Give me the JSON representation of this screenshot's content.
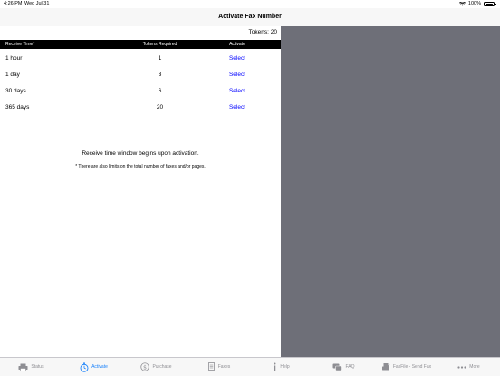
{
  "status_bar": {
    "time": "4:26 PM",
    "date": "Wed Jul 31",
    "battery": "100%"
  },
  "nav": {
    "title": "Activate Fax Number"
  },
  "tokens": {
    "label": "Tokens:",
    "value": "20"
  },
  "table": {
    "headers": [
      "Receive Time*",
      "Tokens Required",
      "Activate"
    ],
    "rows": [
      {
        "time": "1 hour",
        "tokens": "1",
        "action": "Select"
      },
      {
        "time": "1 day",
        "tokens": "3",
        "action": "Select"
      },
      {
        "time": "30 days",
        "tokens": "6",
        "action": "Select"
      },
      {
        "time": "365 days",
        "tokens": "20",
        "action": "Select"
      }
    ]
  },
  "notes": {
    "line1": "Receive time window begins upon activation.",
    "line2": "* There are also limits on the total number of faxes and/or pages."
  },
  "tabs": [
    {
      "label": "Status",
      "icon": "printer-icon"
    },
    {
      "label": "Activate",
      "icon": "stopwatch-icon"
    },
    {
      "label": "Purchase",
      "icon": "dollar-icon"
    },
    {
      "label": "Faxes",
      "icon": "document-icon"
    },
    {
      "label": "Help",
      "icon": "info-icon"
    },
    {
      "label": "FAQ",
      "icon": "chat-icon"
    },
    {
      "label": "FaxFile - Send Fax",
      "icon": "fax-icon"
    },
    {
      "label": "More",
      "icon": "more-icon"
    }
  ],
  "colors": {
    "accent": "#1a82fb",
    "link": "#0000ff",
    "detail_pane": "#6e6f78",
    "header_bg": "#000000"
  }
}
